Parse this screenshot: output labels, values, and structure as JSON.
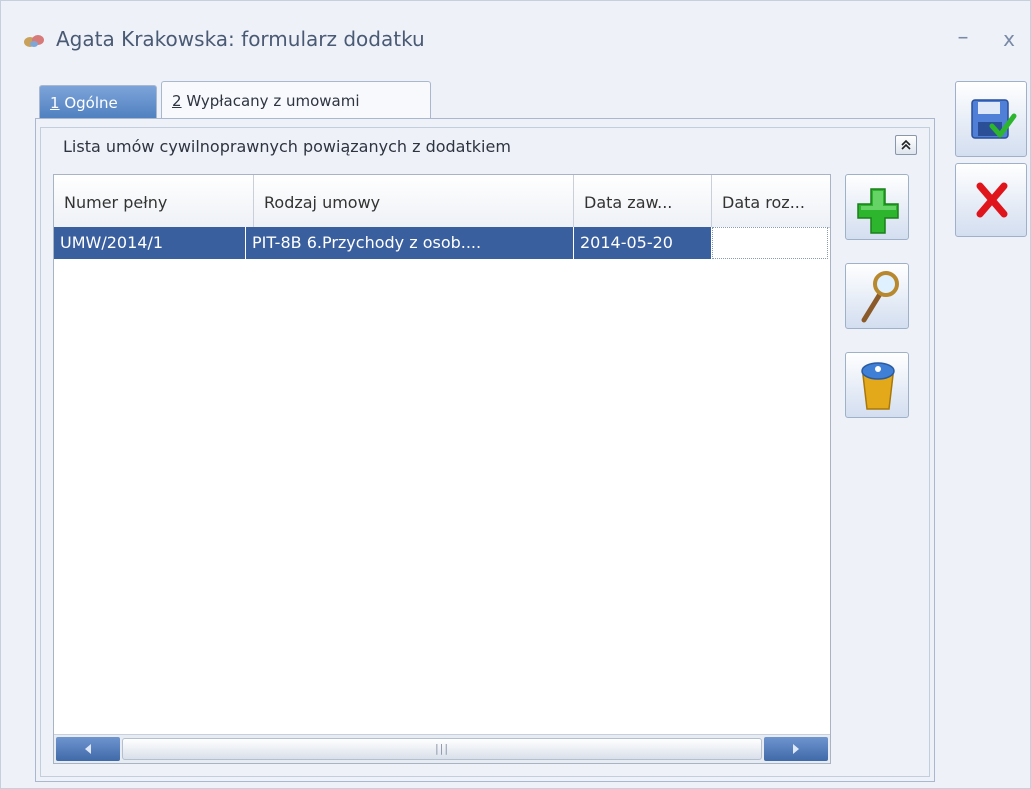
{
  "window": {
    "title": "Agata Krakowska: formularz dodatku",
    "minimize_glyph": "–",
    "close_glyph": "x"
  },
  "tabs": [
    {
      "hotkey": "1",
      "label": " Ogólne",
      "active": true
    },
    {
      "hotkey": "2",
      "label": " Wypłacany z umowami",
      "active": false
    }
  ],
  "group": {
    "label": "Lista umów cywilnoprawnych powiązanych z dodatkiem",
    "collapse_glyph": "⌃"
  },
  "grid": {
    "columns": [
      "Numer pełny",
      "Rodzaj umowy",
      "Data zaw...",
      "Data roz..."
    ],
    "rows": [
      [
        "UMW/2014/1",
        "PIT-8B  6.Przychody z osob....",
        "2014-05-20",
        ""
      ]
    ],
    "scroll_thumb_glyph": "|||"
  },
  "icons": {
    "add": "plus-icon",
    "view": "magnifier-icon",
    "delete": "trash-icon",
    "save": "save-icon",
    "cancel": "cancel-icon"
  },
  "colors": {
    "selection": "#3a5f9f",
    "add_green": "#2db52d",
    "cancel_red": "#e0141b"
  }
}
